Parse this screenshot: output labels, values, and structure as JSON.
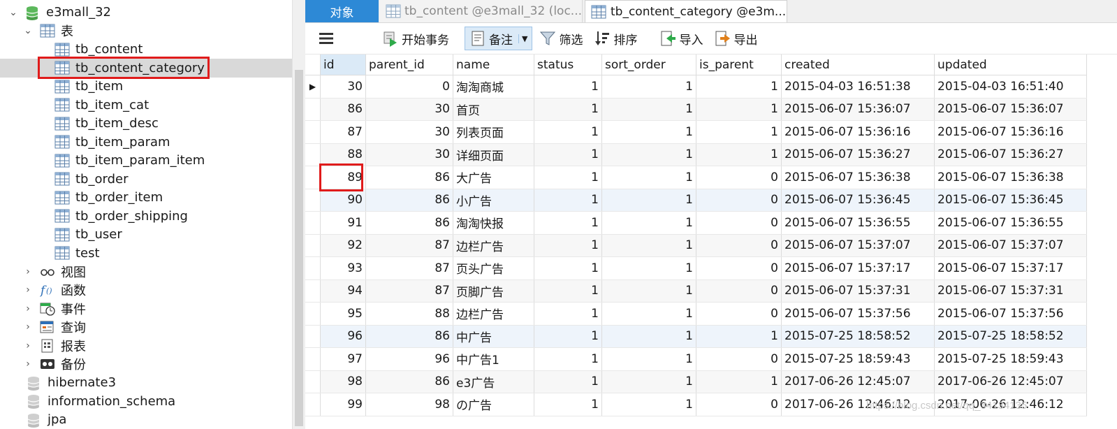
{
  "navigator": {
    "database": "e3mall_32",
    "tables_group": "表",
    "tables": [
      "tb_content",
      "tb_content_category",
      "tb_item",
      "tb_item_cat",
      "tb_item_desc",
      "tb_item_param",
      "tb_item_param_item",
      "tb_order",
      "tb_order_item",
      "tb_order_shipping",
      "tb_user",
      "test"
    ],
    "selected_table": "tb_content_category",
    "groups": [
      {
        "label": "视图",
        "icon": "view-icon"
      },
      {
        "label": "函数",
        "icon": "function-icon"
      },
      {
        "label": "事件",
        "icon": "event-icon"
      },
      {
        "label": "查询",
        "icon": "query-icon"
      },
      {
        "label": "报表",
        "icon": "report-icon"
      },
      {
        "label": "备份",
        "icon": "backup-icon"
      }
    ],
    "other_databases": [
      "hibernate3",
      "information_schema",
      "jpa"
    ]
  },
  "tabs": {
    "objects": "对象",
    "content": "tb_content @e3mall_32 (loc...",
    "category": "tb_content_category @e3m..."
  },
  "toolbar": {
    "begin_transaction": "开始事务",
    "memo": "备注",
    "filter": "筛选",
    "sort": "排序",
    "import": "导入",
    "export": "导出"
  },
  "grid": {
    "columns": [
      "id",
      "parent_id",
      "name",
      "status",
      "sort_order",
      "is_parent",
      "created",
      "updated"
    ],
    "rows": [
      [
        "30",
        "0",
        "淘淘商城",
        "1",
        "1",
        "1",
        "2015-04-03 16:51:38",
        "2015-04-03 16:51:40"
      ],
      [
        "86",
        "30",
        "首页",
        "1",
        "1",
        "1",
        "2015-06-07 15:36:07",
        "2015-06-07 15:36:07"
      ],
      [
        "87",
        "30",
        "列表页面",
        "1",
        "1",
        "1",
        "2015-06-07 15:36:16",
        "2015-06-07 15:36:16"
      ],
      [
        "88",
        "30",
        "详细页面",
        "1",
        "1",
        "1",
        "2015-06-07 15:36:27",
        "2015-06-07 15:36:27"
      ],
      [
        "89",
        "86",
        "大广告",
        "1",
        "1",
        "0",
        "2015-06-07 15:36:38",
        "2015-06-07 15:36:38"
      ],
      [
        "90",
        "86",
        "小广告",
        "1",
        "1",
        "0",
        "2015-06-07 15:36:45",
        "2015-06-07 15:36:45"
      ],
      [
        "91",
        "86",
        "淘淘快报",
        "1",
        "1",
        "0",
        "2015-06-07 15:36:55",
        "2015-06-07 15:36:55"
      ],
      [
        "92",
        "87",
        "边栏广告",
        "1",
        "1",
        "0",
        "2015-06-07 15:37:07",
        "2015-06-07 15:37:07"
      ],
      [
        "93",
        "87",
        "页头广告",
        "1",
        "1",
        "0",
        "2015-06-07 15:37:17",
        "2015-06-07 15:37:17"
      ],
      [
        "94",
        "87",
        "页脚广告",
        "1",
        "1",
        "0",
        "2015-06-07 15:37:31",
        "2015-06-07 15:37:31"
      ],
      [
        "95",
        "88",
        "边栏广告",
        "1",
        "1",
        "0",
        "2015-06-07 15:37:56",
        "2015-06-07 15:37:56"
      ],
      [
        "96",
        "86",
        "中广告",
        "1",
        "1",
        "1",
        "2015-07-25 18:58:52",
        "2015-07-25 18:58:52"
      ],
      [
        "97",
        "96",
        "中广告1",
        "1",
        "1",
        "0",
        "2015-07-25 18:59:43",
        "2015-07-25 18:59:43"
      ],
      [
        "98",
        "86",
        "e3广告",
        "1",
        "1",
        "1",
        "2017-06-26 12:45:07",
        "2017-06-26 12:45:07"
      ],
      [
        "99",
        "98",
        "の广告",
        "1",
        "1",
        "0",
        "2017-06-26 12:46:12",
        "2017-06-26 12:46:12"
      ]
    ],
    "current_row": "30",
    "highlighted_id": "89"
  },
  "watermark": "https://blog.csdn.net/qq_34134135",
  "colors": {
    "accent": "#2d89d6",
    "highlight_box": "#e01b1b",
    "selected_row": "#d9d9d9"
  }
}
